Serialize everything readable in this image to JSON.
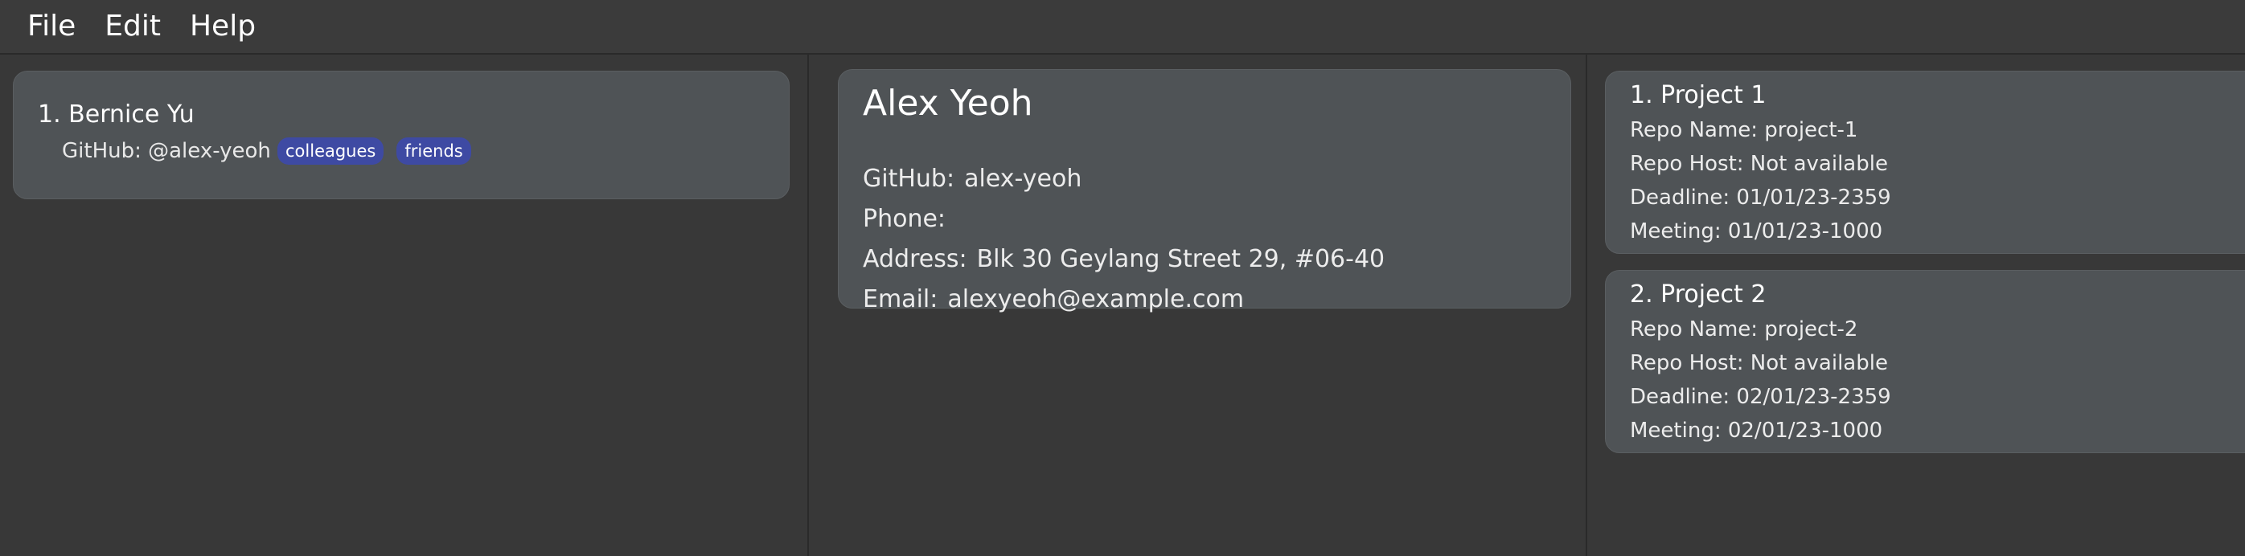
{
  "menu": {
    "file": "File",
    "edit": "Edit",
    "help": "Help"
  },
  "person_list": [
    {
      "index_name": "1.  Bernice Yu",
      "github": "GitHub: @alex-yeoh",
      "tags": [
        "colleagues",
        "friends"
      ]
    }
  ],
  "detail": {
    "name": "Alex Yeoh",
    "github_label": "GitHub:",
    "github_value": "alex-yeoh",
    "phone_label": "Phone:",
    "phone_value": "",
    "address_label": "Address:",
    "address_value": "Blk 30 Geylang Street 29, #06-40",
    "email_label": "Email:",
    "email_value": "alexyeoh@example.com"
  },
  "projects": [
    {
      "title": "1.  Project 1",
      "repo_name": "Repo Name: project-1",
      "repo_host": "Repo Host: Not available",
      "deadline": "Deadline: 01/01/23-2359",
      "meeting": "Meeting: 01/01/23-1000"
    },
    {
      "title": "2.  Project 2",
      "repo_name": "Repo Name: project-2",
      "repo_host": "Repo Host: Not available",
      "deadline": "Deadline: 02/01/23-2359",
      "meeting": "Meeting: 02/01/23-1000"
    }
  ],
  "colors": {
    "background": "#383838",
    "card": "#4f5356",
    "tag": "#3e4aa3",
    "text": "#ffffff"
  }
}
